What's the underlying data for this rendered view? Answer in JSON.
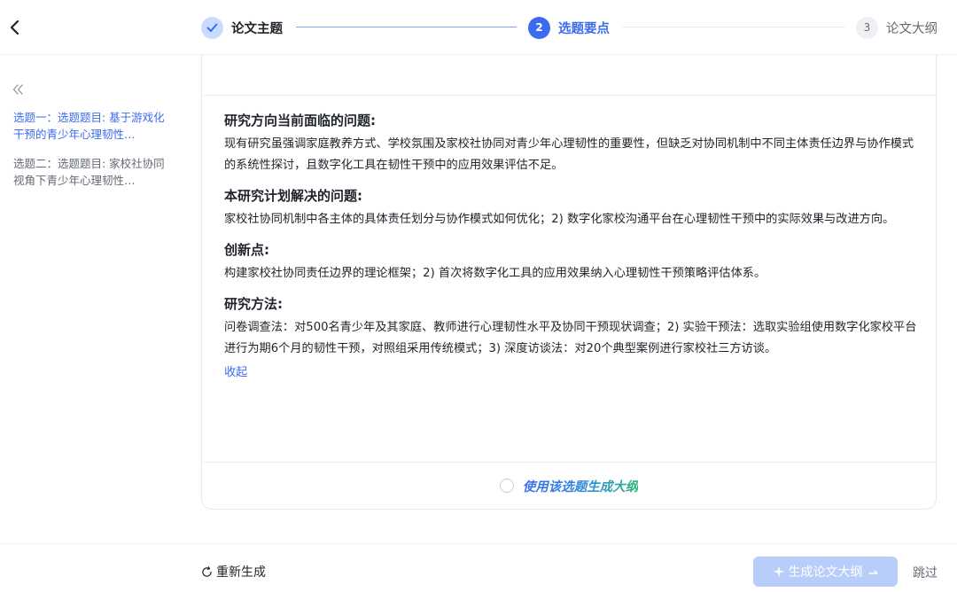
{
  "steps": [
    {
      "number": "",
      "label": "论文主题",
      "status": "completed"
    },
    {
      "number": "2",
      "label": "选题要点",
      "status": "active"
    },
    {
      "number": "3",
      "label": "论文大纲",
      "status": "pending"
    }
  ],
  "sidebar": {
    "items": [
      {
        "label": "选题一：选题题目: 基于游戏化干预的青少年心理韧性…",
        "selected": true
      },
      {
        "label": "选题二：选题题目: 家校社协同视角下青少年心理韧性…",
        "selected": false
      }
    ]
  },
  "content": {
    "sections": [
      {
        "title": "研究方向当前面临的问题:",
        "text": "现有研究虽强调家庭教养方式、学校氛围及家校社协同对青少年心理韧性的重要性，但缺乏对协同机制中不同主体责任边界与协作模式的系统性探讨，且数字化工具在韧性干预中的应用效果评估不足。"
      },
      {
        "title": "本研究计划解决的问题:",
        "text": "家校社协同机制中各主体的具体责任划分与协作模式如何优化；2) 数字化家校沟通平台在心理韧性干预中的实际效果与改进方向。"
      },
      {
        "title": "创新点:",
        "text": "构建家校社协同责任边界的理论框架；2) 首次将数字化工具的应用效果纳入心理韧性干预策略评估体系。"
      },
      {
        "title": "研究方法:",
        "text": "问卷调查法：对500名青少年及其家庭、教师进行心理韧性水平及协同干预现状调查；2) 实验干预法：选取实验组使用数字化家校平台进行为期6个月的韧性干预，对照组采用传统模式；3) 深度访谈法：对20个典型案例进行家校社三方访谈。"
      }
    ],
    "collapse_label": "收起",
    "use_topic_label": "使用该选题生成大纲"
  },
  "footer": {
    "regenerate_label": "重新生成",
    "generate_label": "生成论文大纲",
    "skip_label": "跳过"
  },
  "colors": {
    "primary": "#3b6cf0",
    "primary_disabled": "#b8cdfa",
    "text": "#1f2329",
    "muted": "#646a73"
  }
}
